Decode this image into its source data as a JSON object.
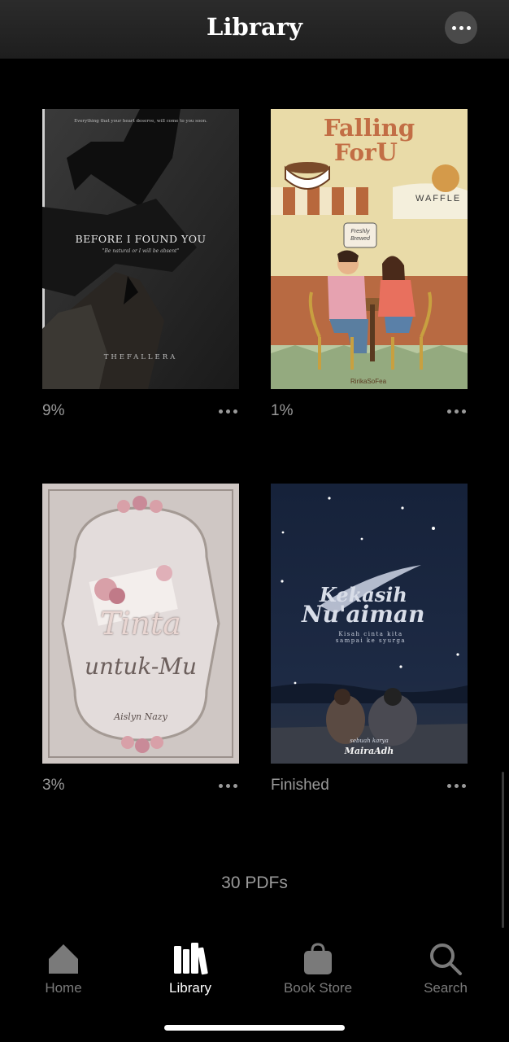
{
  "header": {
    "title": "Library"
  },
  "books": [
    {
      "progress": "9%",
      "cover": {
        "tagline": "Everything that your heart deserve, will come to you soon.",
        "title": "BEFORE I FOUND YOU",
        "subtitle": "\"Be natural or I will be absent\"",
        "author": "THEFALLERA"
      }
    },
    {
      "progress": "1%",
      "cover": {
        "title_line1": "Falling",
        "title_line2": "For",
        "title_u": "U",
        "sign": "WAFFLE",
        "board": "Freshly Brewed",
        "author": "RirikaSoFea"
      }
    },
    {
      "progress": "3%",
      "cover": {
        "title_line1": "Tinta",
        "title_line2": "untuk-Mu",
        "author": "Aislyn Nazy"
      }
    },
    {
      "progress": "Finished",
      "cover": {
        "title_line1": "Kekasih",
        "title_line2": "Nu'aiman",
        "subtitle": "Kisah cinta kita sampai ke syurga",
        "byline": "sebuah karya",
        "author": "MairaAdh"
      }
    }
  ],
  "footer": {
    "count": "30 PDFs"
  },
  "tabs": [
    {
      "label": "Home",
      "icon": "home-icon",
      "active": false
    },
    {
      "label": "Library",
      "icon": "library-icon",
      "active": true
    },
    {
      "label": "Book Store",
      "icon": "bag-icon",
      "active": false
    },
    {
      "label": "Search",
      "icon": "search-icon",
      "active": false
    }
  ],
  "colors": {
    "accent": "#ffffff",
    "inactive": "#7a7a7a",
    "background": "#000000"
  }
}
